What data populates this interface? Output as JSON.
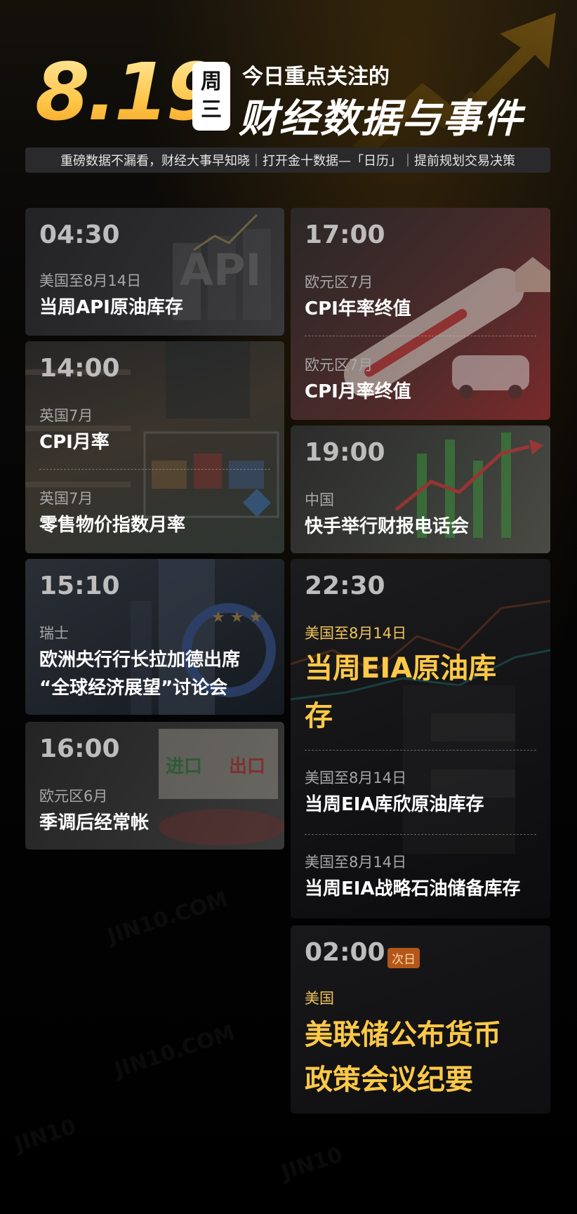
{
  "header": {
    "date": "8.19",
    "weekday_line1": "周",
    "weekday_line2": "三",
    "headline_small": "今日重点关注的",
    "headline_big": "财经数据与事件",
    "tagline": "重磅数据不漏看，财经大事早知晓｜打开金十数据—「日历」｜提前规划交易决策"
  },
  "left_column": [
    {
      "time": "04:30",
      "events": [
        {
          "region": "美国至8月14日",
          "title": "当周API原油库存"
        }
      ]
    },
    {
      "time": "14:00",
      "events": [
        {
          "region": "英国7月",
          "title": "CPI月率"
        },
        {
          "region": "英国7月",
          "title": "零售物价指数月率"
        }
      ]
    },
    {
      "time": "15:10",
      "events": [
        {
          "region": "瑞士",
          "title_line1": "欧洲央行行长拉加德出席",
          "title_line2": "“全球经济展望”讨论会"
        }
      ]
    },
    {
      "time": "16:00",
      "events": [
        {
          "region": "欧元区6月",
          "title": "季调后经常帐"
        }
      ],
      "image_text": {
        "left": "进口",
        "right": "出口"
      }
    }
  ],
  "right_column": [
    {
      "time": "17:00",
      "events": [
        {
          "region": "欧元区7月",
          "title": "CPI年率终值"
        },
        {
          "region": "欧元区7月",
          "title": "CPI月率终值"
        }
      ]
    },
    {
      "time": "19:00",
      "events": [
        {
          "region": "中国",
          "title": "快手举行财报电话会"
        }
      ]
    },
    {
      "time": "22:30",
      "events": [
        {
          "region": "美国至8月14日",
          "title_line1": "当周EIA原油库",
          "title_line2": "存",
          "highlight": true
        },
        {
          "region": "美国至8月14日",
          "title": "当周EIA库欣原油库存"
        },
        {
          "region": "美国至8月14日",
          "title": "当周EIA战略石油储备库存"
        }
      ]
    },
    {
      "time": "02:00",
      "badge": "次日",
      "events": [
        {
          "region": "美国",
          "title_line1": "美联储公布货币",
          "title_line2": "政策会议纪要",
          "highlight": true
        }
      ]
    }
  ],
  "colors": {
    "gold": "#ffc948",
    "background": "#000000",
    "card": "#1c1c1e",
    "badge": "#b4561a"
  }
}
